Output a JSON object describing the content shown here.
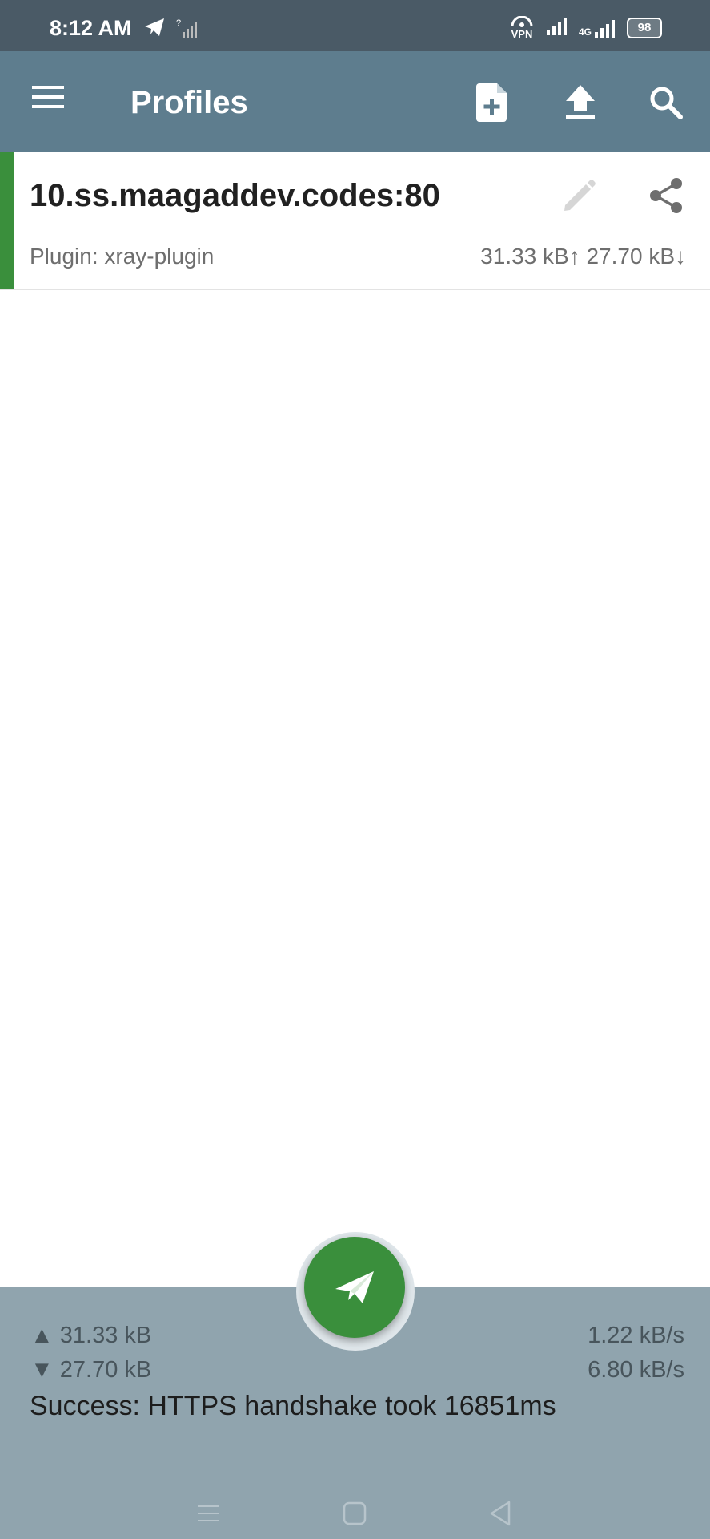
{
  "status_bar": {
    "time": "8:12 AM",
    "vpn_label": "VPN",
    "network_type": "4G",
    "battery": "98",
    "icons": [
      "telegram-icon",
      "no-sim-signal-icon",
      "vpn-icon",
      "signal-icon",
      "signal-4g-icon",
      "battery-icon"
    ]
  },
  "app_bar": {
    "title": "Profiles",
    "icons": [
      "menu-icon",
      "add-file-icon",
      "upload-icon",
      "search-icon"
    ]
  },
  "profiles": [
    {
      "name": "10.ss.maagaddev.codes:80",
      "plugin": "Plugin: xray-plugin",
      "traffic": "31.33 kB↑ 27.70 kB↓",
      "active": true
    }
  ],
  "stats": {
    "tx_total": "▲ 31.33 kB",
    "rx_total": "▼ 27.70 kB",
    "tx_rate": "1.22 kB/s",
    "rx_rate": "6.80 kB/s",
    "message": "Success: HTTPS handshake took 16851ms"
  },
  "colors": {
    "status_bar": "#4a5a66",
    "app_bar": "#5e7d8e",
    "accent_green": "#3a8f3c",
    "stats_panel": "#90a4ae"
  }
}
